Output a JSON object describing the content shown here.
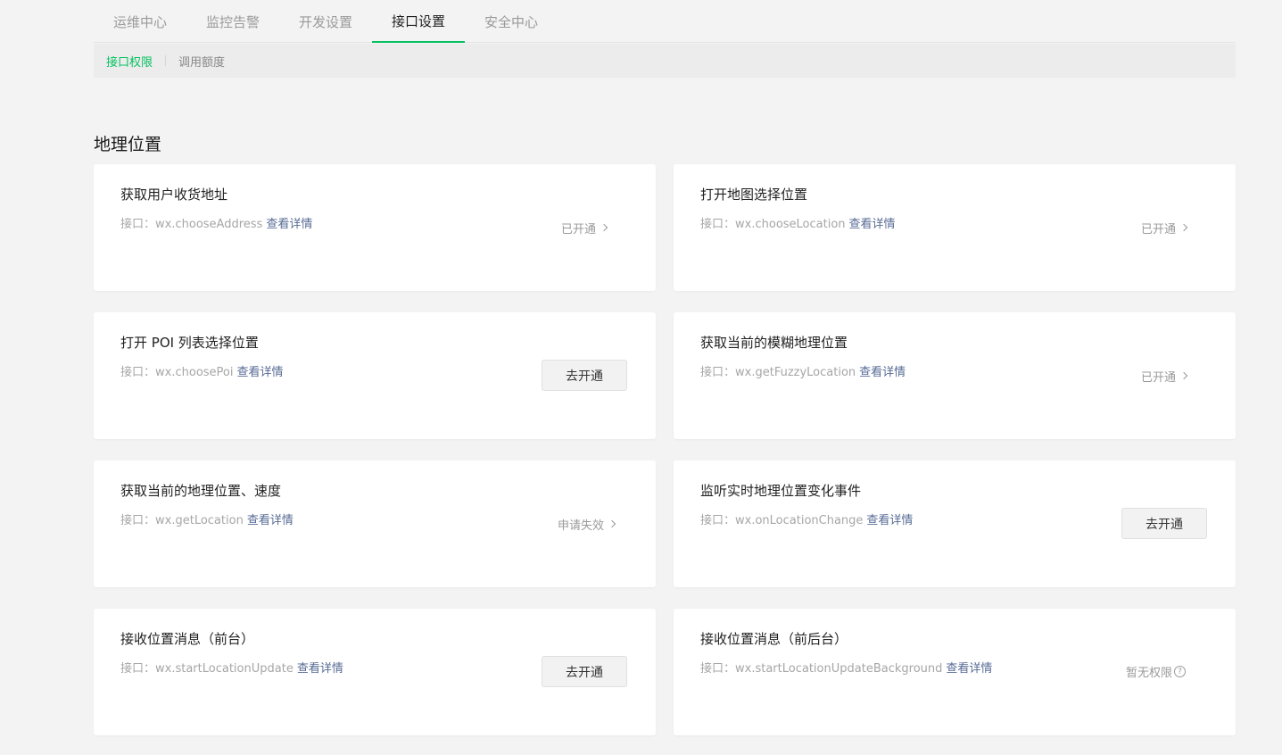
{
  "topnav": {
    "tabs": [
      {
        "label": "运维中心"
      },
      {
        "label": "监控告警"
      },
      {
        "label": "开发设置"
      },
      {
        "label": "接口设置"
      },
      {
        "label": "安全中心"
      }
    ],
    "active_index": 3
  },
  "subnav": {
    "items": [
      {
        "label": "接口权限"
      },
      {
        "label": "调用额度"
      }
    ],
    "active_index": 0
  },
  "section": {
    "title": "地理位置"
  },
  "common": {
    "api_prefix": "接口：",
    "detail_link": "查看详情"
  },
  "cards": [
    {
      "title": "获取用户收货地址",
      "api": "wx.chooseAddress",
      "status_text": "已开通",
      "action": "status"
    },
    {
      "title": "打开地图选择位置",
      "api": "wx.chooseLocation",
      "status_text": "已开通",
      "action": "status"
    },
    {
      "title": "打开 POI 列表选择位置",
      "api": "wx.choosePoi",
      "button_label": "去开通",
      "action": "button"
    },
    {
      "title": "获取当前的模糊地理位置",
      "api": "wx.getFuzzyLocation",
      "status_text": "已开通",
      "action": "status"
    },
    {
      "title": "获取当前的地理位置、速度",
      "api": "wx.getLocation",
      "status_text": "申请失效",
      "action": "status"
    },
    {
      "title": "监听实时地理位置变化事件",
      "api": "wx.onLocationChange",
      "button_label": "去开通",
      "action": "button"
    },
    {
      "title": "接收位置消息（前台）",
      "api": "wx.startLocationUpdate",
      "button_label": "去开通",
      "action": "button"
    },
    {
      "title": "接收位置消息（前后台）",
      "api": "wx.startLocationUpdateBackground",
      "status_text": "暂无权限",
      "action": "help"
    }
  ],
  "colors": {
    "accent": "#07c160",
    "link": "#576b95",
    "background": "#f3f3f3"
  }
}
